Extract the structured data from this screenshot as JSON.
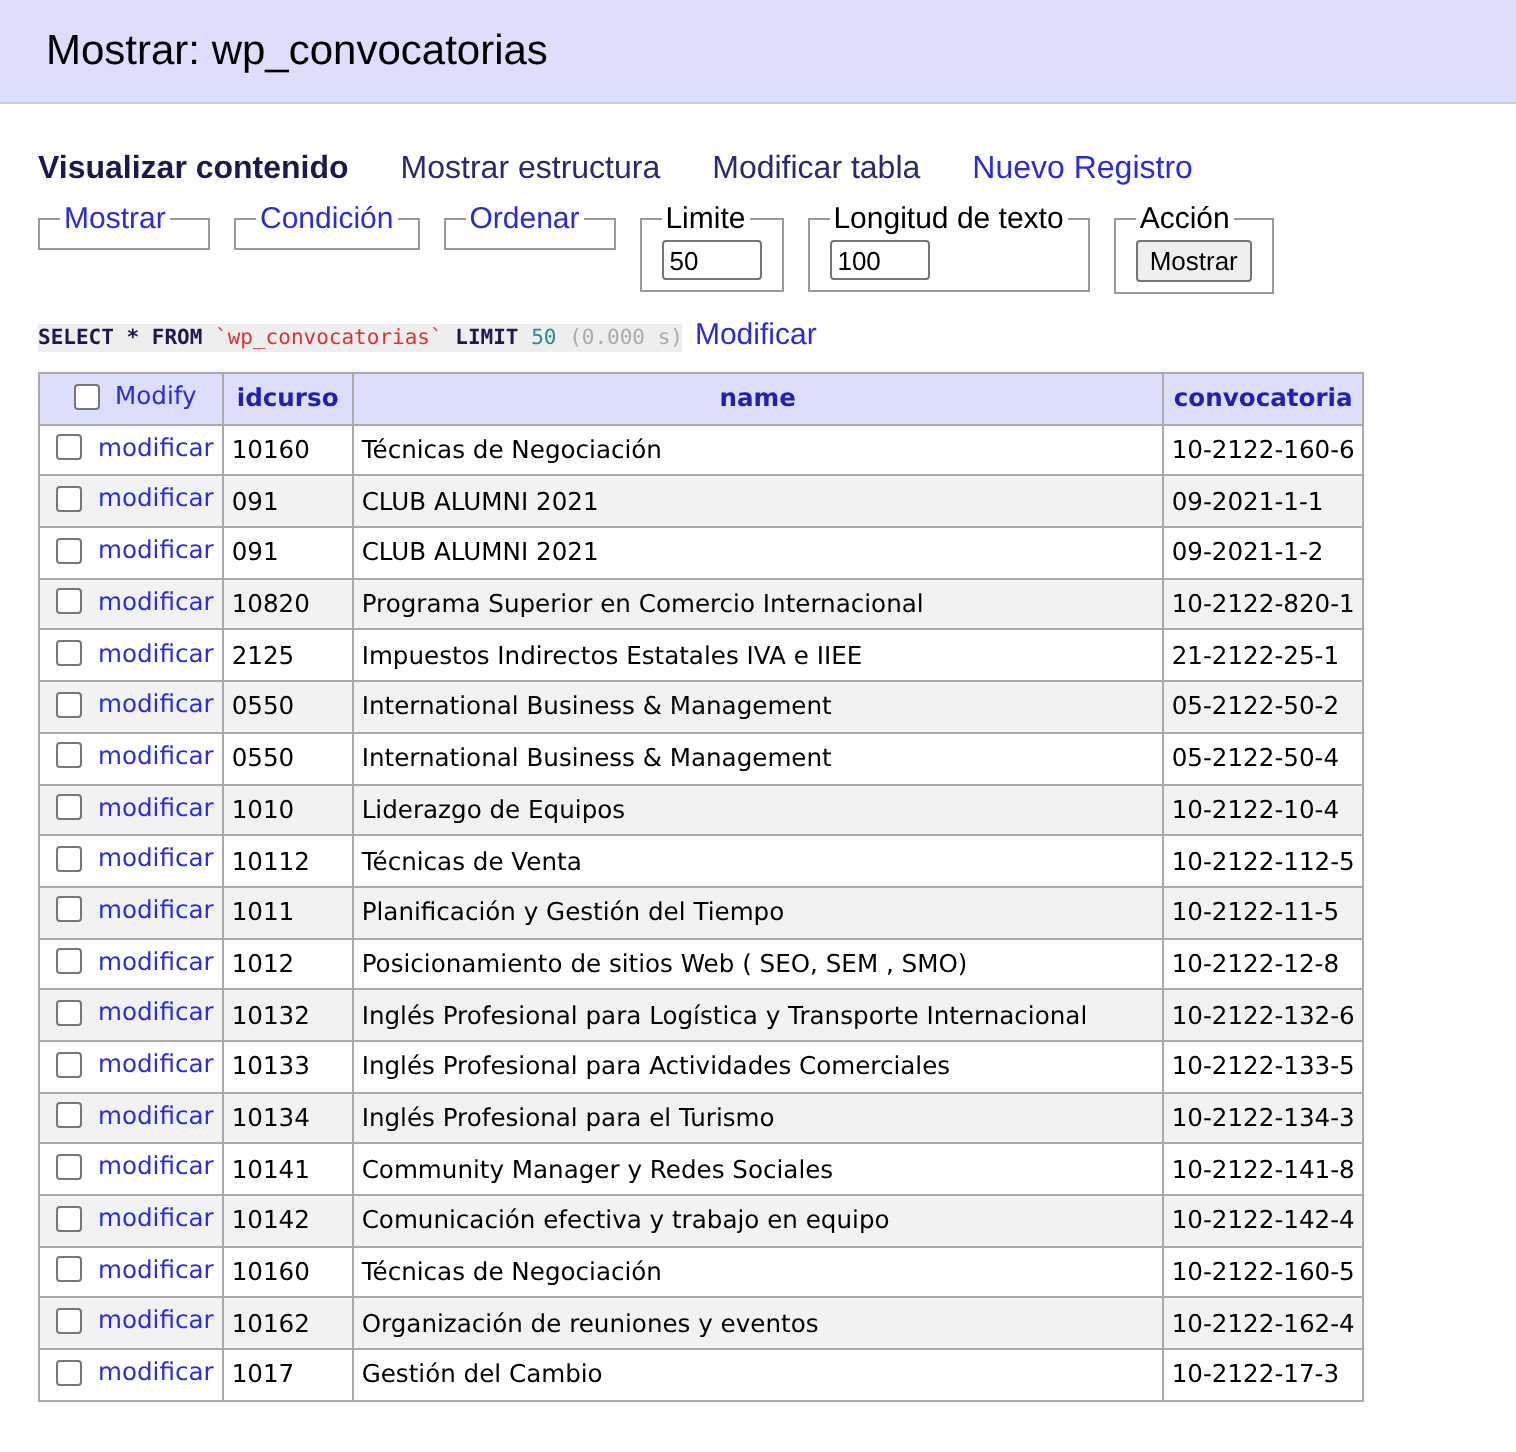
{
  "title": "Mostrar: wp_convocatorias",
  "tabs": [
    {
      "label": "Visualizar contenido",
      "selected": true,
      "kind": "tab"
    },
    {
      "label": "Mostrar estructura",
      "selected": false,
      "kind": "tab"
    },
    {
      "label": "Modificar tabla",
      "selected": false,
      "kind": "tab"
    },
    {
      "label": "Nuevo Registro",
      "selected": false,
      "kind": "link"
    }
  ],
  "fieldsets": [
    {
      "legend": "Mostrar",
      "kind": "collapsed"
    },
    {
      "legend": "Condición",
      "kind": "collapsed"
    },
    {
      "legend": "Ordenar",
      "kind": "collapsed"
    },
    {
      "legend": "Limite",
      "kind": "input",
      "value": "50"
    },
    {
      "legend": "Longitud de texto",
      "kind": "input",
      "value": "100"
    },
    {
      "legend": "Acción",
      "kind": "button",
      "button": "Mostrar"
    }
  ],
  "sql": {
    "parts": [
      {
        "text": "SELECT * FROM",
        "kind": "keyword"
      },
      {
        "text": "`wp_convocatorias`",
        "kind": "identifier"
      },
      {
        "text": "LIMIT",
        "kind": "keyword"
      },
      {
        "text": "50",
        "kind": "number"
      }
    ],
    "time": "(0.000 s)",
    "edit_link": "Modificar"
  },
  "table": {
    "select_all": {
      "checked": false,
      "label": "Modify"
    },
    "columns": [
      "idcurso",
      "name",
      "convocatoria"
    ],
    "rows": [
      {
        "checked": false,
        "action": "modificar",
        "cells": [
          "10160",
          "Técnicas de Negociación",
          "10-2122-160-6"
        ]
      },
      {
        "checked": false,
        "action": "modificar",
        "cells": [
          "091",
          "CLUB ALUMNI 2021",
          "09-2021-1-1"
        ]
      },
      {
        "checked": false,
        "action": "modificar",
        "cells": [
          "091",
          "CLUB ALUMNI 2021",
          "09-2021-1-2"
        ]
      },
      {
        "checked": false,
        "action": "modificar",
        "cells": [
          "10820",
          "Programa Superior en Comercio Internacional",
          "10-2122-820-1"
        ]
      },
      {
        "checked": false,
        "action": "modificar",
        "cells": [
          "2125",
          "Impuestos Indirectos Estatales IVA e IIEE",
          "21-2122-25-1"
        ]
      },
      {
        "checked": false,
        "action": "modificar",
        "cells": [
          "0550",
          "International Business & Management",
          "05-2122-50-2"
        ]
      },
      {
        "checked": false,
        "action": "modificar",
        "cells": [
          "0550",
          "International Business & Management",
          "05-2122-50-4"
        ]
      },
      {
        "checked": false,
        "action": "modificar",
        "cells": [
          "1010",
          "Liderazgo de Equipos",
          "10-2122-10-4"
        ]
      },
      {
        "checked": false,
        "action": "modificar",
        "cells": [
          "10112",
          "Técnicas de Venta",
          "10-2122-112-5"
        ]
      },
      {
        "checked": false,
        "action": "modificar",
        "cells": [
          "1011",
          "Planificación y Gestión del Tiempo",
          "10-2122-11-5"
        ]
      },
      {
        "checked": false,
        "action": "modificar",
        "cells": [
          "1012",
          "Posicionamiento de sitios Web ( SEO, SEM , SMO)",
          "10-2122-12-8"
        ]
      },
      {
        "checked": false,
        "action": "modificar",
        "cells": [
          "10132",
          "Inglés Profesional para Logística y Transporte Internacional",
          "10-2122-132-6"
        ]
      },
      {
        "checked": false,
        "action": "modificar",
        "cells": [
          "10133",
          "Inglés Profesional para Actividades Comerciales",
          "10-2122-133-5"
        ]
      },
      {
        "checked": false,
        "action": "modificar",
        "cells": [
          "10134",
          "Inglés Profesional para el Turismo",
          "10-2122-134-3"
        ]
      },
      {
        "checked": false,
        "action": "modificar",
        "cells": [
          "10141",
          "Community Manager y Redes Sociales",
          "10-2122-141-8"
        ]
      },
      {
        "checked": false,
        "action": "modificar",
        "cells": [
          "10142",
          "Comunicación efectiva y trabajo en equipo",
          "10-2122-142-4"
        ]
      },
      {
        "checked": false,
        "action": "modificar",
        "cells": [
          "10160",
          "Técnicas de Negociación",
          "10-2122-160-5"
        ]
      },
      {
        "checked": false,
        "action": "modificar",
        "cells": [
          "10162",
          "Organización de reuniones y eventos",
          "10-2122-162-4"
        ]
      },
      {
        "checked": false,
        "action": "modificar",
        "cells": [
          "1017",
          "Gestión del Cambio",
          "10-2122-17-3"
        ]
      }
    ]
  }
}
